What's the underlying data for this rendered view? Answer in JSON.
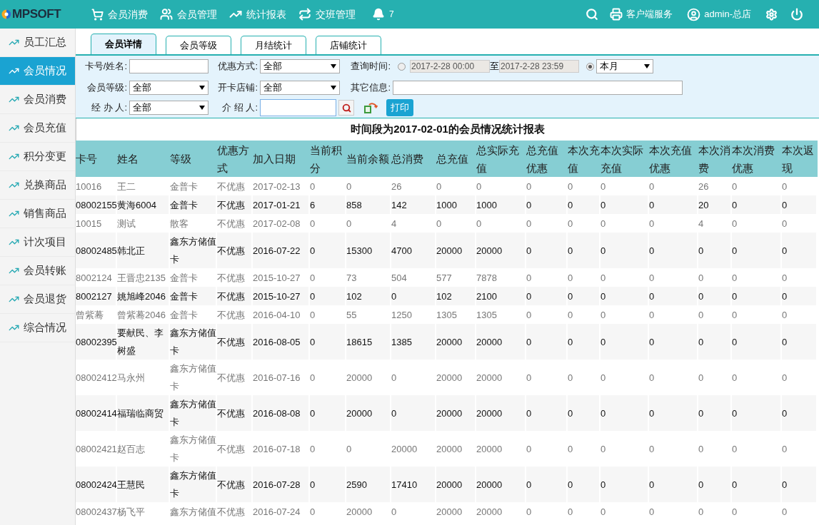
{
  "brand": "MPSOFT",
  "nav": [
    {
      "kind": "cart",
      "label": "会员消费"
    },
    {
      "kind": "users",
      "label": "会员管理"
    },
    {
      "kind": "chart",
      "label": "统计报表"
    },
    {
      "kind": "swap",
      "label": "交班管理"
    }
  ],
  "notification_count": "7",
  "header_right": {
    "service": "客户端服务",
    "user": "admin-总店"
  },
  "sidebar": [
    {
      "label": "员工汇总",
      "selected": false
    },
    {
      "label": "会员情况",
      "selected": true
    },
    {
      "label": "会员消费",
      "selected": false
    },
    {
      "label": "会员充值",
      "selected": false
    },
    {
      "label": "积分变更",
      "selected": false
    },
    {
      "label": "兑换商品",
      "selected": false
    },
    {
      "label": "销售商品",
      "selected": false
    },
    {
      "label": "计次项目",
      "selected": false
    },
    {
      "label": "会员转账",
      "selected": false
    },
    {
      "label": "会员退货",
      "selected": false
    },
    {
      "label": "综合情况",
      "selected": false
    }
  ],
  "tabs": [
    {
      "label": "会员详情",
      "selected": true
    },
    {
      "label": "会员等级",
      "selected": false
    },
    {
      "label": "月结统计",
      "selected": false
    },
    {
      "label": "店铺统计",
      "selected": false
    }
  ],
  "filters": {
    "card_name": {
      "label": "卡号/姓名:"
    },
    "discount": {
      "label": "优惠方式:",
      "value": "全部"
    },
    "query_time": {
      "label": "查询时间:",
      "custom": {
        "selected": false,
        "from": "2017-2-28 00:00",
        "to_label": "至",
        "to": "2017-2-28 23:59"
      },
      "preset": {
        "selected": true,
        "value": "本月"
      }
    },
    "level": {
      "label": "会员等级:",
      "value": "全部"
    },
    "store": {
      "label": "开卡店铺:",
      "value": "全部"
    },
    "other": {
      "label": "其它信息:"
    },
    "handler": {
      "label": "经 办 人:",
      "value": "全部"
    },
    "referrer": {
      "label": "介 绍 人:"
    },
    "print": "打印"
  },
  "report": {
    "title": "时间段为2017-02-01的会员情况统计报表",
    "columns": [
      "卡号",
      "姓名",
      "等级",
      "优惠方式",
      "加入日期",
      "当前积分",
      "当前余额",
      "总消费",
      "总充值",
      "总实际充值",
      "总充值优惠",
      "本次充值",
      "本次实际充值",
      "本次充值优惠",
      "本次消费",
      "本次消费优惠",
      "本次返现"
    ],
    "rows": [
      [
        "10016",
        "王二",
        "金普卡",
        "不优惠",
        "2017-02-13",
        "0",
        "0",
        "26",
        "0",
        "0",
        "0",
        "0",
        "0",
        "0",
        "26",
        "0",
        "0"
      ],
      [
        "08002155",
        "黄海6004",
        "金普卡",
        "不优惠",
        "2017-01-21",
        "6",
        "858",
        "142",
        "1000",
        "1000",
        "0",
        "0",
        "0",
        "0",
        "20",
        "0",
        "0"
      ],
      [
        "10015",
        "测试",
        "散客",
        "不优惠",
        "2017-02-08",
        "0",
        "0",
        "4",
        "0",
        "0",
        "0",
        "0",
        "0",
        "0",
        "4",
        "0",
        "0"
      ],
      [
        "08002485",
        "韩北正",
        "鑫东方储值卡",
        "不优惠",
        "2016-07-22",
        "0",
        "15300",
        "4700",
        "20000",
        "20000",
        "0",
        "0",
        "0",
        "0",
        "0",
        "0",
        "0"
      ],
      [
        "8002124",
        "王晋忠2135",
        "金普卡",
        "不优惠",
        "2015-10-27",
        "0",
        "73",
        "504",
        "577",
        "7878",
        "0",
        "0",
        "0",
        "0",
        "0",
        "0",
        "0"
      ],
      [
        "8002127",
        "姚旭峰2046",
        "金普卡",
        "不优惠",
        "2015-10-27",
        "0",
        "102",
        "0",
        "102",
        "2100",
        "0",
        "0",
        "0",
        "0",
        "0",
        "0",
        "0"
      ],
      [
        "曾紫蓦",
        "曾紫蓦2046",
        "金普卡",
        "不优惠",
        "2016-04-10",
        "0",
        "55",
        "1250",
        "1305",
        "1305",
        "0",
        "0",
        "0",
        "0",
        "0",
        "0",
        "0"
      ],
      [
        "08002395",
        "要献民、李树盛",
        "鑫东方储值卡",
        "不优惠",
        "2016-08-05",
        "0",
        "18615",
        "1385",
        "20000",
        "20000",
        "0",
        "0",
        "0",
        "0",
        "0",
        "0",
        "0"
      ],
      [
        "08002412",
        "马永州",
        "鑫东方储值卡",
        "不优惠",
        "2016-07-16",
        "0",
        "20000",
        "0",
        "20000",
        "20000",
        "0",
        "0",
        "0",
        "0",
        "0",
        "0",
        "0"
      ],
      [
        "08002414",
        "福瑞临商贸",
        "鑫东方储值卡",
        "不优惠",
        "2016-08-08",
        "0",
        "20000",
        "0",
        "20000",
        "20000",
        "0",
        "0",
        "0",
        "0",
        "0",
        "0",
        "0"
      ],
      [
        "08002421",
        "赵百志",
        "鑫东方储值卡",
        "不优惠",
        "2016-07-18",
        "0",
        "0",
        "20000",
        "20000",
        "20000",
        "0",
        "0",
        "0",
        "0",
        "0",
        "0",
        "0"
      ],
      [
        "08002424",
        "王慧民",
        "鑫东方储值卡",
        "不优惠",
        "2016-07-28",
        "0",
        "2590",
        "17410",
        "20000",
        "20000",
        "0",
        "0",
        "0",
        "0",
        "0",
        "0",
        "0"
      ],
      [
        "08002437",
        "杨飞平",
        "鑫东方储值",
        "不优惠",
        "2016-07-24",
        "0",
        "20000",
        "0",
        "20000",
        "20000",
        "0",
        "0",
        "0",
        "0",
        "0",
        "0",
        "0"
      ]
    ]
  }
}
